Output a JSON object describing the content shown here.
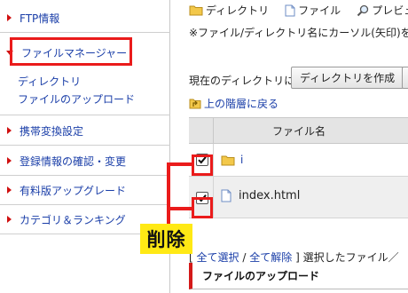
{
  "sidebar": {
    "items": [
      {
        "label": "FTP情報"
      },
      {
        "label": "ファイルマネージャー"
      },
      {
        "label": "携帯変換設定"
      },
      {
        "label": "登録情報の確認・変更"
      },
      {
        "label": "有料版アップグレード"
      },
      {
        "label": "カテゴリ＆ランキング"
      }
    ],
    "sub_items": [
      {
        "label": "ディレクトリ"
      },
      {
        "label": "ファイルのアップロード"
      }
    ]
  },
  "legend": {
    "directory": "ディレクトリ",
    "file": "ファイル",
    "preview": "プレビュ"
  },
  "note": "※ファイル/ディレクトリ名にカーソル(矢印)をの",
  "toolbar": {
    "current_dir_label": "現在のディレクトリに",
    "create_dir_button": "ディレクトリを作成"
  },
  "up_link": "上の階層に戻る",
  "table": {
    "header": "ファイル名",
    "rows": [
      {
        "name": "i",
        "type": "directory",
        "checked": true
      },
      {
        "name": "index.html",
        "type": "file",
        "checked": true
      }
    ]
  },
  "bottom": {
    "open_bracket": "[",
    "select_all": "全て選択",
    "separator": "/",
    "deselect_all": "全て解除",
    "close_bracket": "]",
    "selected_text": "選択したファイル／"
  },
  "upload_heading": "ファイルのアップロード",
  "annotation": {
    "label": "削除",
    "color": "#ea1b1b",
    "label_bg": "#ffe915"
  }
}
